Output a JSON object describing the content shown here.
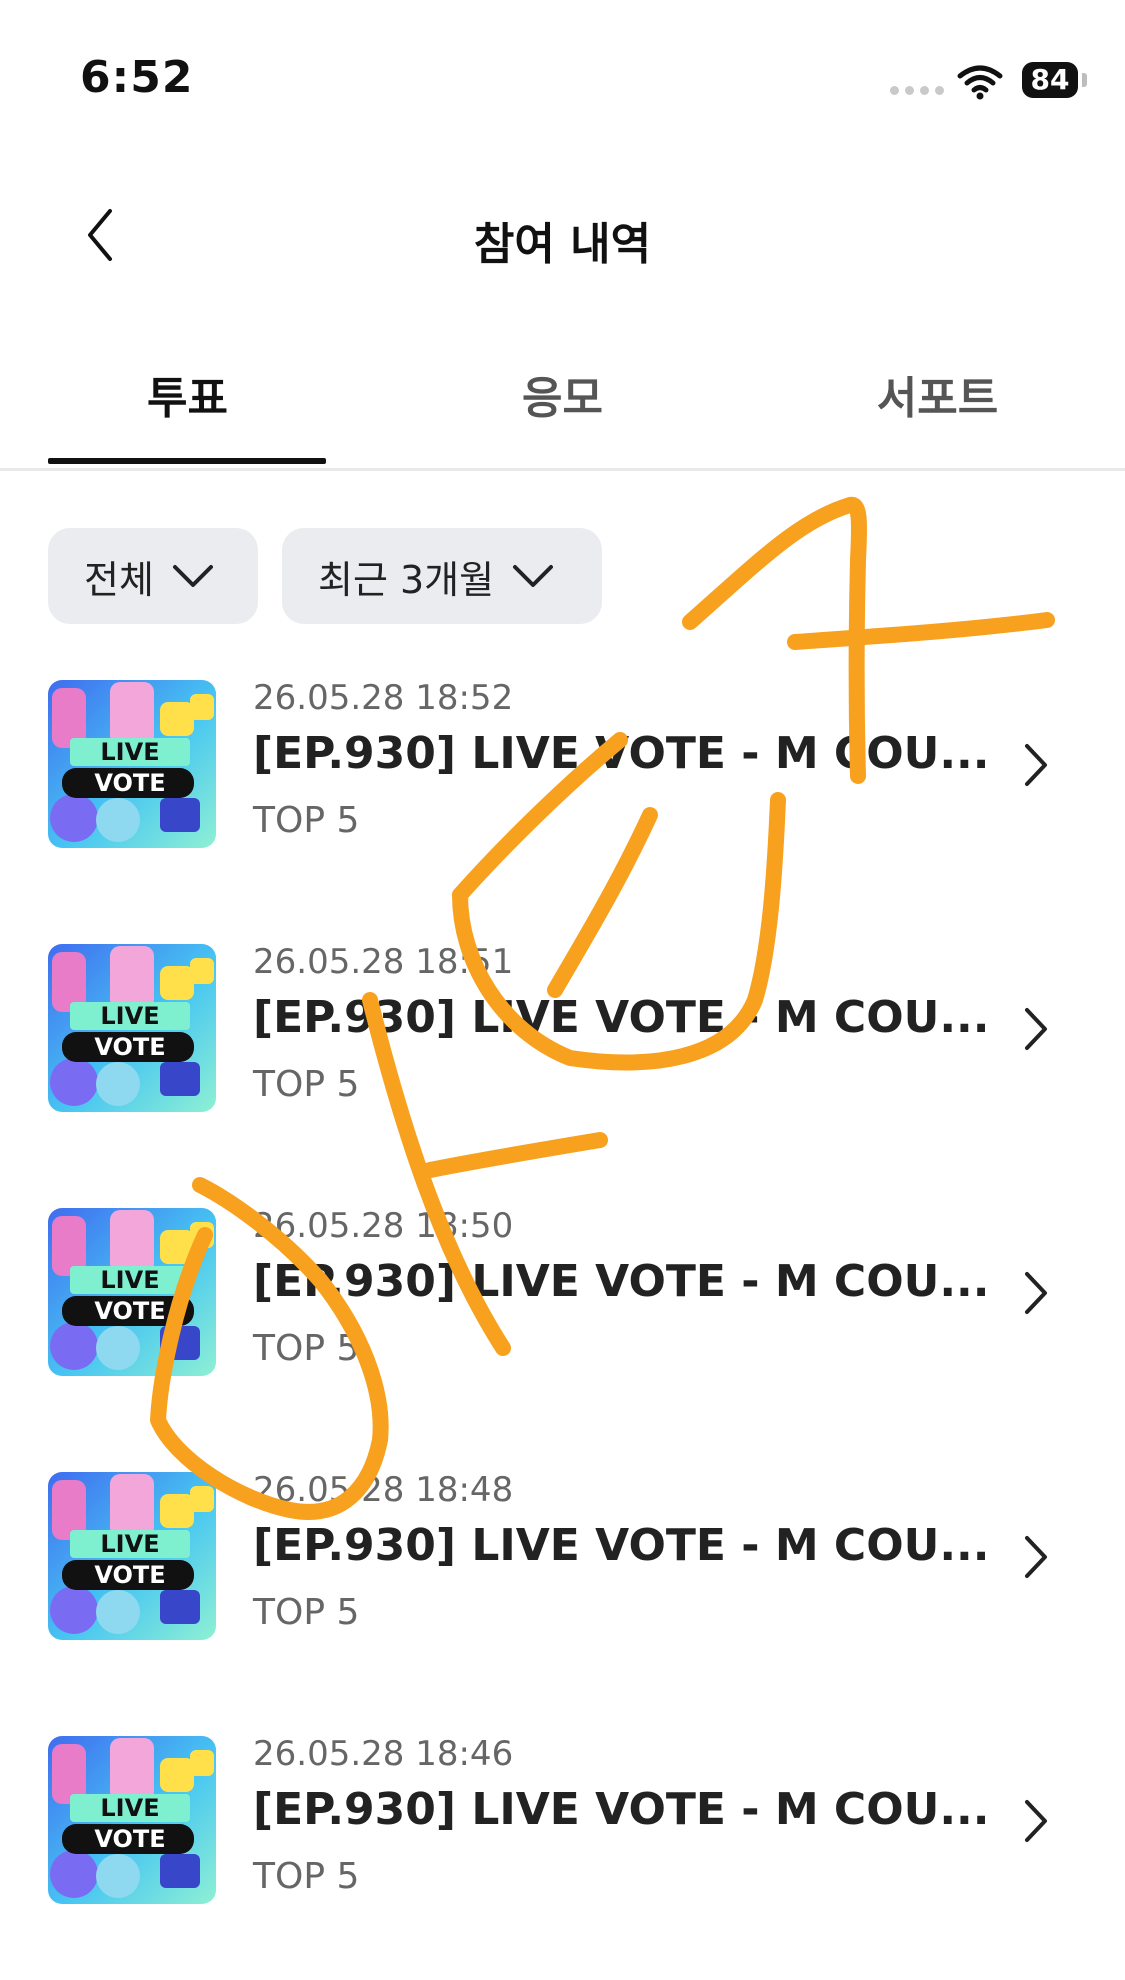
{
  "status_bar": {
    "time": "6:52",
    "battery": "84"
  },
  "header": {
    "title": "참여 내역"
  },
  "tabs": [
    {
      "label": "투표",
      "active": true
    },
    {
      "label": "응모",
      "active": false
    },
    {
      "label": "서포트",
      "active": false
    }
  ],
  "filters": [
    {
      "label": "전체"
    },
    {
      "label": "최근 3개월"
    }
  ],
  "thumbnail": {
    "line1": "LIVE",
    "line2": "VOTE"
  },
  "items": [
    {
      "date": "26.05.28 18:52",
      "title": "[EP.930] LIVE VOTE - M COU...",
      "subtitle": "TOP 5"
    },
    {
      "date": "26.05.28 18:51",
      "title": "[EP.930] LIVE VOTE - M COU...",
      "subtitle": "TOP 5"
    },
    {
      "date": "26.05.28 18:50",
      "title": "[EP.930] LIVE VOTE - M COU...",
      "subtitle": "TOP 5"
    },
    {
      "date": "26.05.28 18:48",
      "title": "[EP.930] LIVE VOTE - M COU...",
      "subtitle": "TOP 5"
    },
    {
      "date": "26.05.28 18:46",
      "title": "[EP.930] LIVE VOTE - M COU...",
      "subtitle": "TOP 5"
    }
  ],
  "colors": {
    "accent": "#111111",
    "chip_bg": "#ebecef",
    "scribble": "#f7a11f"
  }
}
